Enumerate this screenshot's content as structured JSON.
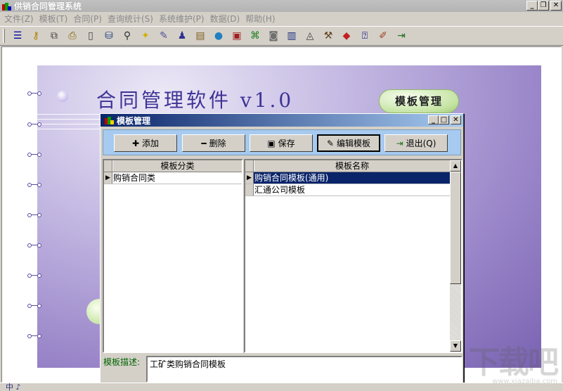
{
  "window": {
    "title": "供销合同管理系统"
  },
  "menu": [
    {
      "label": "文件",
      "key": "(Z)"
    },
    {
      "label": "模板",
      "key": "(T)"
    },
    {
      "label": "合同",
      "key": "(P)"
    },
    {
      "label": "查询统计",
      "key": "(S)"
    },
    {
      "label": "系统维护",
      "key": "(P)"
    },
    {
      "label": "数据",
      "key": "(D)"
    },
    {
      "label": "帮助",
      "key": "(H)"
    }
  ],
  "toolbar_icons": [
    "list-icon",
    "key-icon",
    "copy-icon",
    "print-icon",
    "new-doc-icon",
    "database-icon",
    "search-icon",
    "bulb-icon",
    "tools-icon",
    "users-icon",
    "cards-icon",
    "globe-icon",
    "id-card-icon",
    "gift-icon",
    "box-icon",
    "document-icon",
    "triangle-icon",
    "hammer-icon",
    "book-icon",
    "help-icon",
    "brush-icon",
    "exit-icon"
  ],
  "banner": {
    "title": "合同管理软件 v1.0",
    "badge": "模板管理"
  },
  "dialog": {
    "title": "模板管理",
    "buttons": {
      "add": "添加",
      "delete": "删除",
      "save": "保存",
      "edit": "编辑模板",
      "exit": "退出(Q)"
    },
    "category_grid": {
      "header": "模板分类",
      "rows": [
        "购销合同类"
      ]
    },
    "template_grid": {
      "header": "模板名称",
      "rows": [
        "购销合同模板(通用)",
        "汇通公司模板"
      ]
    },
    "description_label": "模板描述:",
    "description_value": "工矿类购销合同模板"
  },
  "statusbar": {
    "text": "中 ♪"
  },
  "watermark": {
    "text": "下载吧",
    "sub": "www.xiazaiba.com"
  }
}
